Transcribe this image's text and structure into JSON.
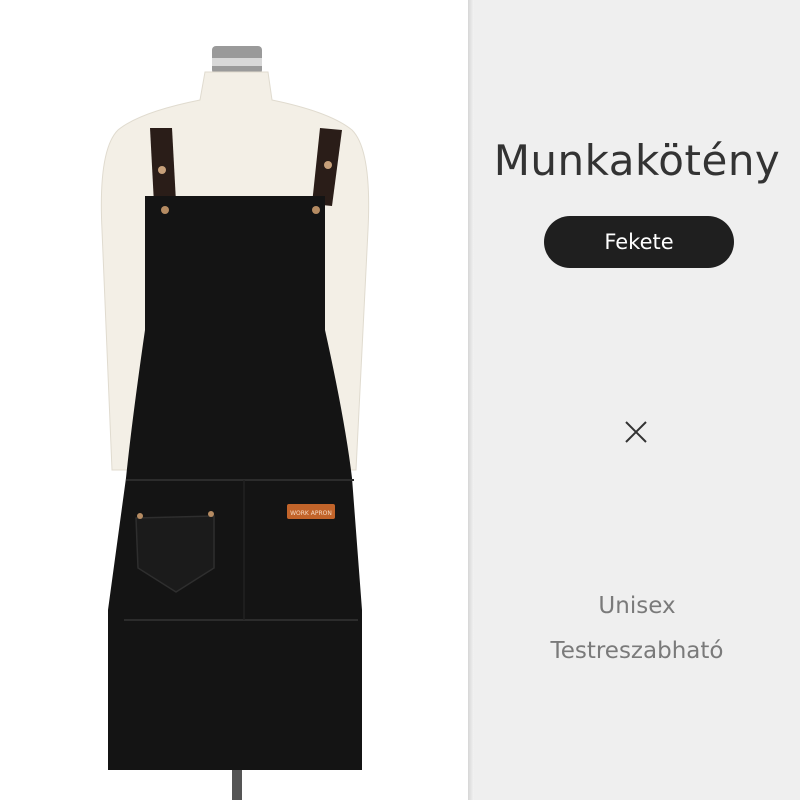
{
  "product": {
    "title": "Munkakötény",
    "color_label": "Fekete",
    "close_icon": "close-icon",
    "features": [
      "Unisex",
      "Testreszabható"
    ],
    "tag_text": "WORK APRON"
  },
  "colors": {
    "apron": "#141414",
    "pill": "#1f1f1f",
    "strap": "#2a1d18",
    "tag": "#c2642a"
  }
}
